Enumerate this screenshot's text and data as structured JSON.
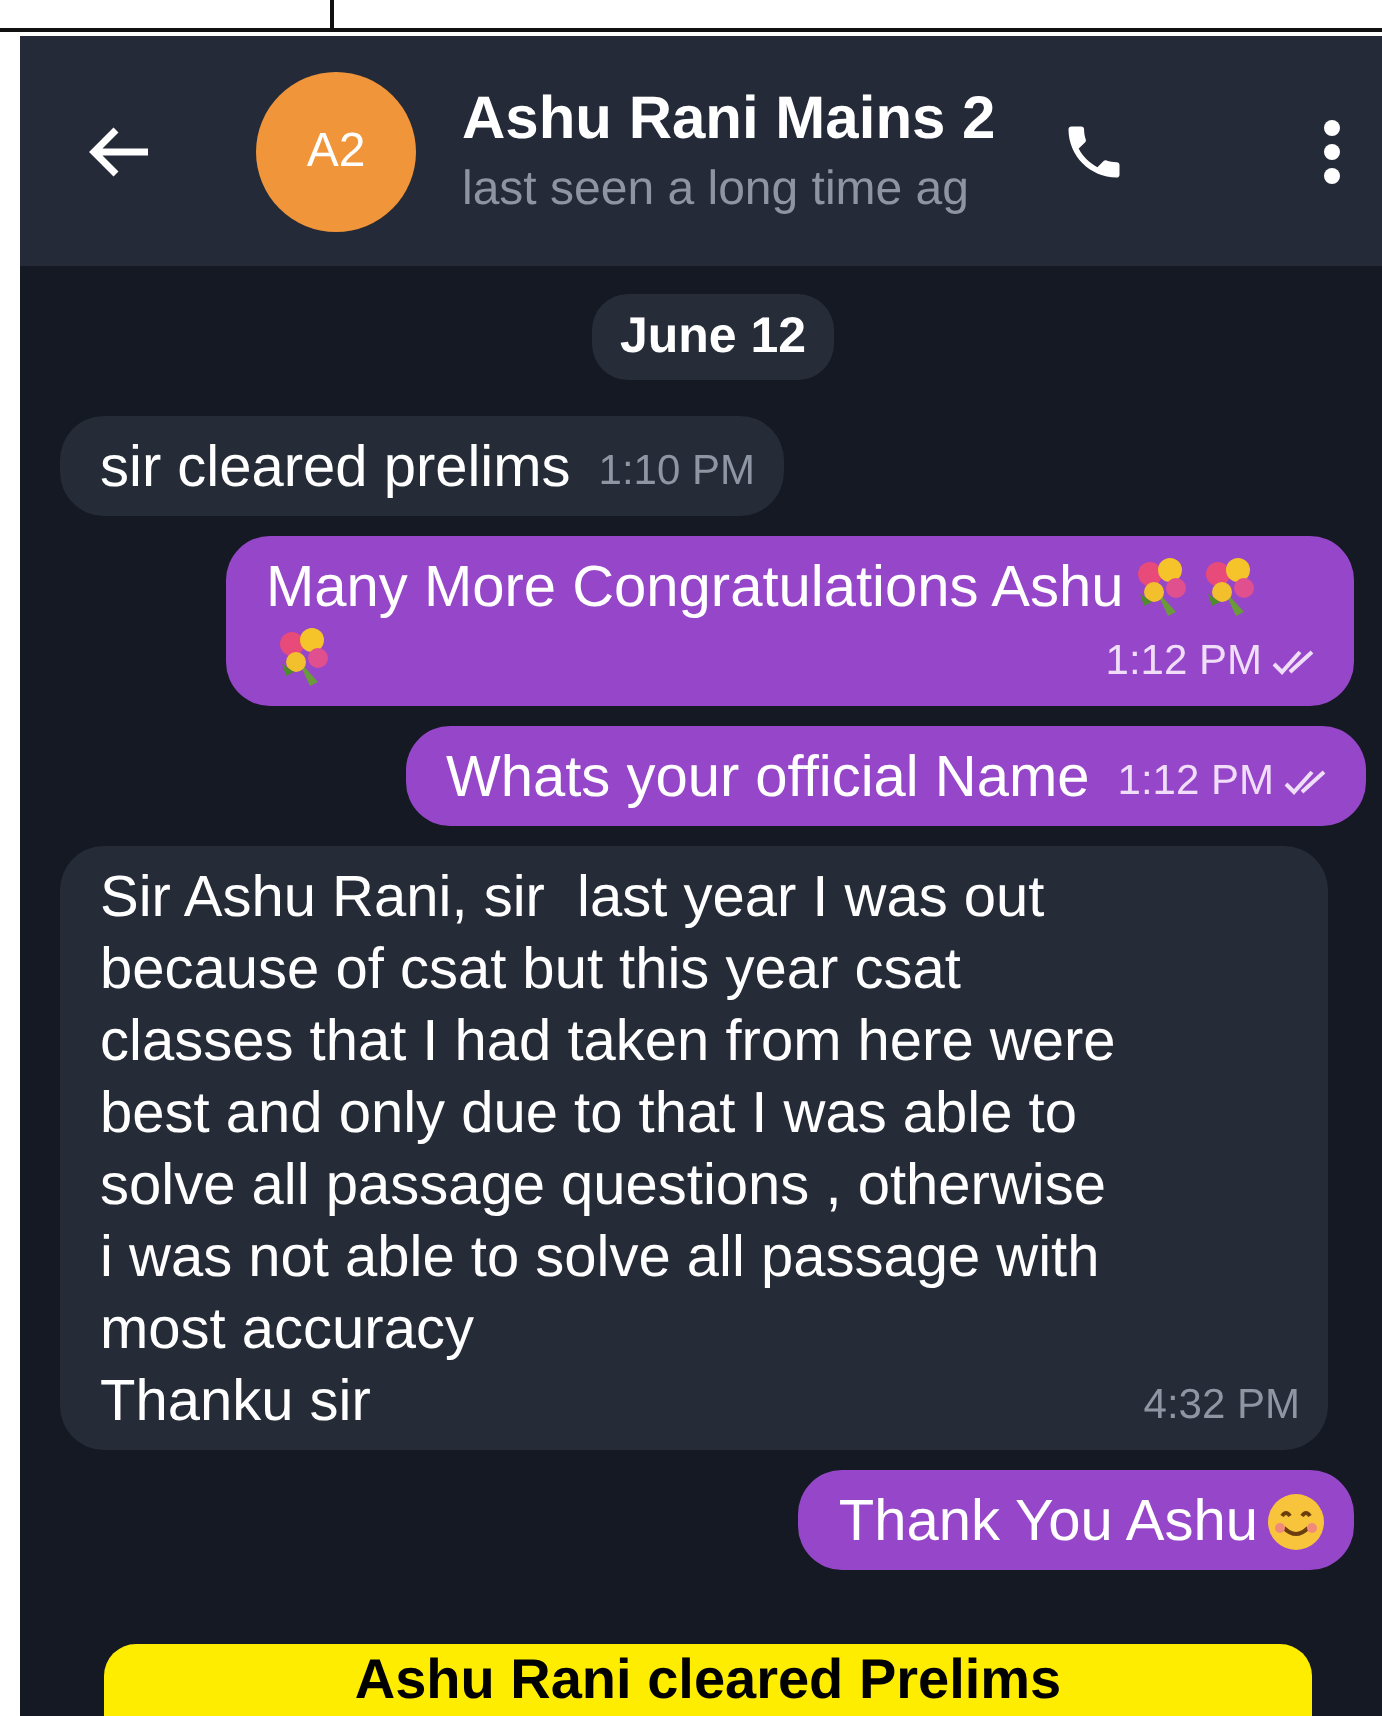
{
  "header": {
    "avatar": {
      "initials": "A2",
      "color": "#f0953a"
    },
    "name": "Ashu Rani Mains 2",
    "status": "last seen a long time ag"
  },
  "date": "June 12",
  "messages": [
    {
      "kind": "incoming",
      "text": "sir cleared prelims",
      "time": "1:10 PM"
    },
    {
      "kind": "outgoing",
      "text": "Many More Congratulations Ashu",
      "stickers": [
        {
          "kind": "bouquet"
        },
        {
          "kind": "bouquet"
        },
        {
          "kind": "bouquet"
        }
      ],
      "time": "1:12 PM",
      "read": true
    },
    {
      "kind": "outgoing",
      "text": "Whats your official Name",
      "time": "1:12 PM",
      "read": true
    },
    {
      "kind": "incoming",
      "text": "Sir Ashu Rani, sir  last year I was out\nbecause of csat but this year csat\nclasses that I had taken from here were\nbest and only due to that I was able to\nsolve all passage questions , otherwise\ni was not able to solve all passage with\nmost accuracy\nThanku sir",
      "time": "4:32 PM"
    },
    {
      "kind": "outgoing",
      "text": "Thank You Ashu",
      "stickers": [
        {
          "kind": "smile"
        }
      ]
    }
  ],
  "banner": "Ashu Rani cleared Prelims"
}
